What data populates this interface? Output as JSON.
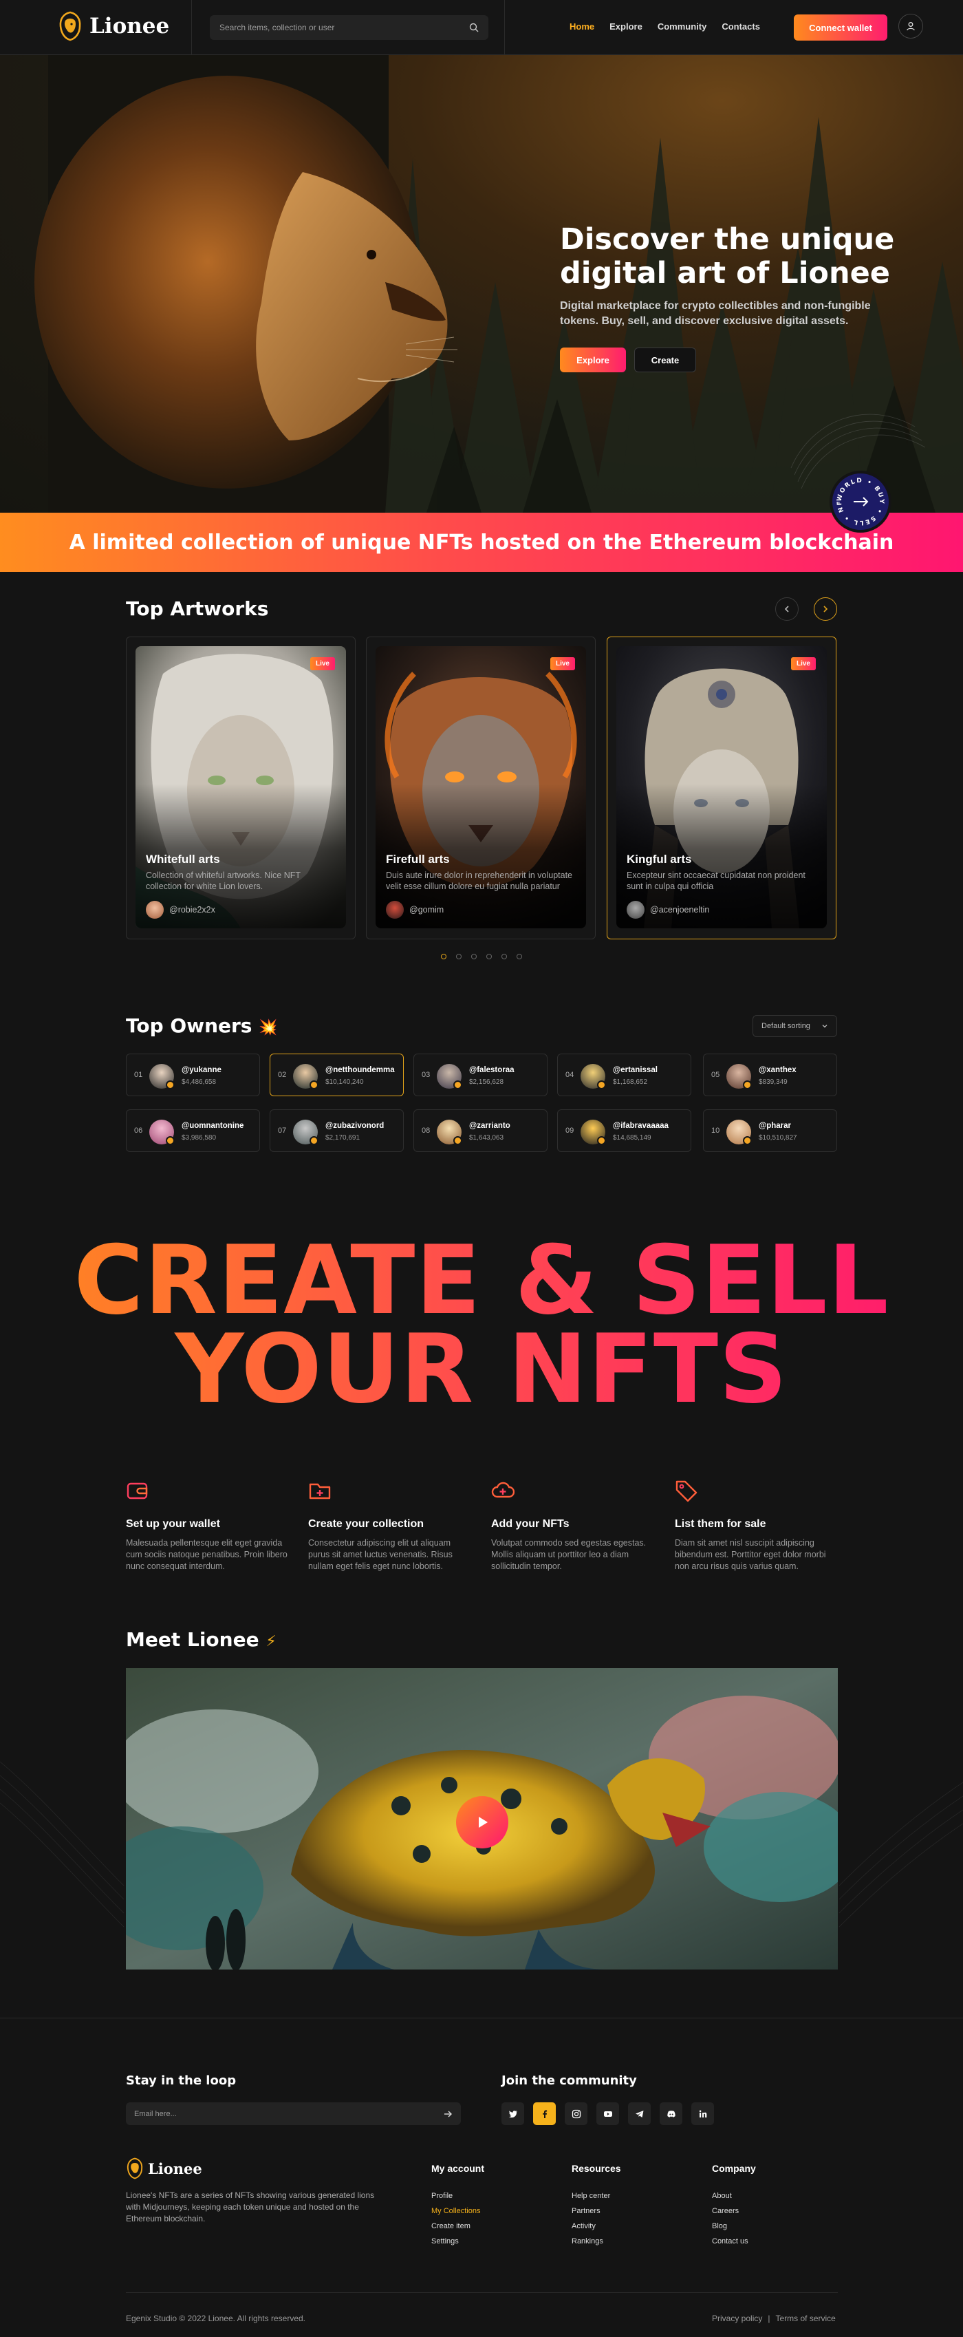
{
  "header": {
    "logo_text": "Lionee",
    "search_placeholder": "Search items, collection or user",
    "nav": [
      "Home",
      "Explore",
      "Community",
      "Contacts"
    ],
    "connect_label": "Connect wallet"
  },
  "hero": {
    "title": "Discover the unique digital art of Lionee",
    "subtitle": "Digital marketplace for crypto collectibles and non-fungible tokens. Buy, sell, and discover exclusive digital assets.",
    "explore_label": "Explore",
    "create_label": "Create",
    "badge_text": "WORLD • BUY • SELL • NFT •"
  },
  "banner": {
    "text": "A limited collection of unique NFTs hosted on the Ethereum blockchain"
  },
  "artworks": {
    "heading": "Top Artworks",
    "items": [
      {
        "live": "Live",
        "title": "Whitefull arts",
        "desc": "Collection of whiteful artworks. Nice NFT collection for white Lion lovers.",
        "owner": "@robie2x2x"
      },
      {
        "live": "Live",
        "title": "Firefull arts",
        "desc": "Duis aute irure dolor in reprehenderit in voluptate velit esse cillum dolore eu fugiat nulla pariatur",
        "owner": "@gomim"
      },
      {
        "live": "Live",
        "title": "Kingful arts",
        "desc": "Excepteur sint occaecat cupidatat non proident sunt in culpa qui officia",
        "owner": "@acenjoeneltin"
      }
    ]
  },
  "owners": {
    "heading": "Top Owners",
    "heading_emoji": "💥",
    "sort_label": "Default sorting",
    "items": [
      {
        "num": "01",
        "name": "@yukanne",
        "value": "$4,486,658"
      },
      {
        "num": "02",
        "name": "@netthoundemma",
        "value": "$10,140,240"
      },
      {
        "num": "03",
        "name": "@falestoraa",
        "value": "$2,156,628"
      },
      {
        "num": "04",
        "name": "@ertanissal",
        "value": "$1,168,652"
      },
      {
        "num": "05",
        "name": "@xanthex",
        "value": "$839,349"
      },
      {
        "num": "06",
        "name": "@uomnantonine",
        "value": "$3,986,580"
      },
      {
        "num": "07",
        "name": "@zubazivonord",
        "value": "$2,170,691"
      },
      {
        "num": "08",
        "name": "@zarrianto",
        "value": "$1,643,063"
      },
      {
        "num": "09",
        "name": "@ifabravaaaaa",
        "value": "$14,685,149"
      },
      {
        "num": "10",
        "name": "@pharar",
        "value": "$10,510,827"
      }
    ]
  },
  "create": {
    "line1": "CREATE & SELL",
    "line2": "YOUR NFTS"
  },
  "steps": [
    {
      "icon": "wallet-icon",
      "title": "Set up your wallet",
      "desc": "Malesuada pellentesque elit eget gravida cum sociis natoque penatibus. Proin libero nunc consequat interdum."
    },
    {
      "icon": "add-folder-icon",
      "title": "Create your collection",
      "desc": "Consectetur adipiscing elit ut aliquam purus sit amet luctus venenatis. Risus nullam eget felis eget nunc lobortis."
    },
    {
      "icon": "cloud-upload-icon",
      "title": "Add your NFTs",
      "desc": "Volutpat commodo sed egestas egestas. Mollis aliquam ut porttitor leo a diam sollicitudin tempor."
    },
    {
      "icon": "price-tag-icon",
      "title": "List them for sale",
      "desc": "Diam sit amet nisl suscipit adipiscing bibendum est. Porttitor eget dolor morbi non arcu risus quis varius quam."
    }
  ],
  "meet": {
    "heading": "Meet Lionee",
    "heading_emoji": "⚡"
  },
  "footer": {
    "loop_heading": "Stay in the loop",
    "email_placeholder": "Email here...",
    "community_heading": "Join the community",
    "logo_text": "Lionee",
    "about": "Lionee's NFTs are a series of NFTs showing various generated lions with Midjourneys, keeping each token unique and hosted on the Ethereum blockchain.",
    "columns": [
      {
        "title": "My account",
        "links": [
          "Profile",
          "My Collections",
          "Create item",
          "Settings"
        ]
      },
      {
        "title": "Resources",
        "links": [
          "Help center",
          "Partners",
          "Activity",
          "Rankings"
        ]
      },
      {
        "title": "Company",
        "links": [
          "About",
          "Careers",
          "Blog",
          "Contact us"
        ]
      }
    ],
    "copyright": "Egenix Studio © 2022 Lionee. All rights reserved.",
    "privacy": "Privacy policy",
    "separator": "|",
    "terms": "Terms of service"
  },
  "colors": {
    "accent_orange": "#ff8a1e",
    "accent_pink": "#ff1670",
    "gold": "#e0a21a",
    "bg": "#141414"
  }
}
